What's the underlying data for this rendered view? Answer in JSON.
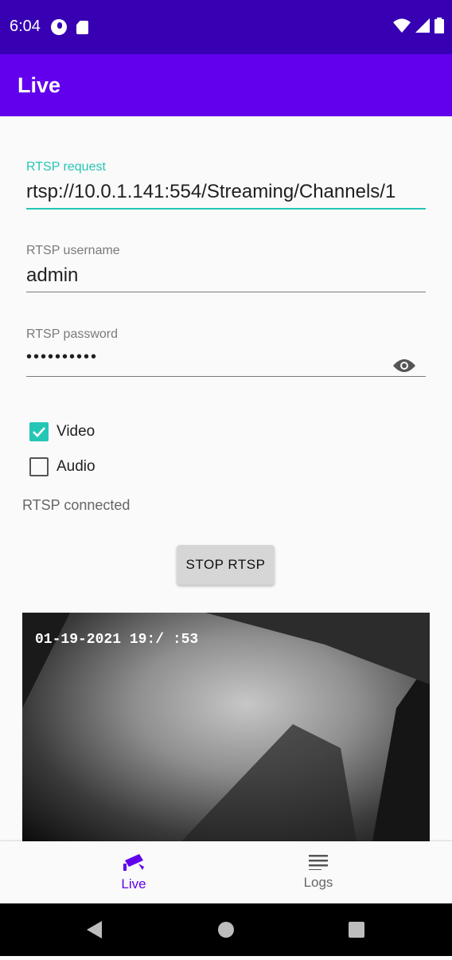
{
  "status_bar": {
    "time": "6:04"
  },
  "app_bar": {
    "title": "Live"
  },
  "form": {
    "request": {
      "label": "RTSP request",
      "value": "rtsp://10.0.1.141:554/Streaming/Channels/1"
    },
    "username": {
      "label": "RTSP username",
      "value": "admin"
    },
    "password": {
      "label": "RTSP password",
      "value": "••••••••••"
    }
  },
  "options": {
    "video": {
      "label": "Video",
      "checked": true
    },
    "audio": {
      "label": "Audio",
      "checked": false
    }
  },
  "connection_status": "RTSP connected",
  "stop_button_label": "STOP RTSP",
  "video": {
    "timestamp": "01-19-2021 19:/ :53"
  },
  "bottom_nav": {
    "items": [
      {
        "label": "Live",
        "icon": "cctv-camera-icon",
        "active": true
      },
      {
        "label": "Logs",
        "icon": "list-lines-icon",
        "active": false
      }
    ]
  },
  "colors": {
    "status_bar": "#3700b3",
    "app_bar": "#6200ee",
    "accent": "#26c6b5"
  }
}
